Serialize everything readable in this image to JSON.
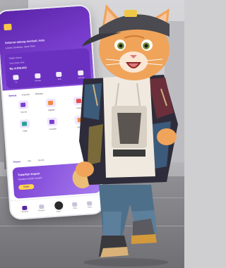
{
  "phone": {
    "greeting": "Selamat datang kembali, Halo",
    "location": "Lokasi: Surabaya, Jawa Timur",
    "card": {
      "label": "Saldo Kamu",
      "sub": "Total Saldo Aktif",
      "value": "Rp 4.200.000",
      "actions": [
        "Isi",
        "Transfer",
        "Tarik",
        "Lainnya"
      ]
    },
    "tabs": [
      "Semua",
      "Favorit",
      "Terbaru"
    ],
    "services": [
      {
        "label": "Top Up",
        "color": "purple"
      },
      {
        "label": "Tagihan",
        "color": "orange"
      },
      {
        "label": "Pulsa",
        "color": "red"
      },
      {
        "label": "Data",
        "color": "teal"
      },
      {
        "label": "Voucher",
        "color": "purple"
      },
      {
        "label": "Lainnya",
        "color": "orange"
      }
    ],
    "section_tabs": [
      "Promo",
      "Info",
      "Berita"
    ],
    "promo": {
      "title": "Tukarkan Kupon",
      "subtitle": "Dapatkan hadiah menarik",
      "button": "Klaim"
    },
    "nav": [
      "Beranda",
      "Riwayat",
      "Bayar",
      "Inbox",
      "Akun"
    ]
  },
  "colors": {
    "brand_purple": "#5a24a8",
    "accent_yellow": "#ffd44d"
  }
}
